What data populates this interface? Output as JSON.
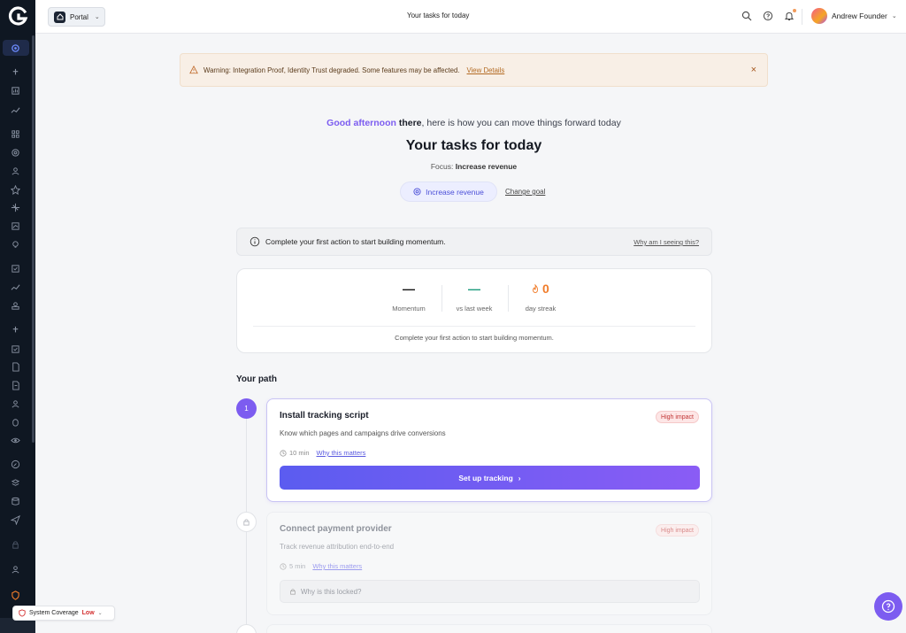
{
  "header": {
    "workspace_label": "Portal",
    "title": "Your tasks for today",
    "user_name": "Andrew Founder"
  },
  "warning": {
    "text": "Warning: Integration Proof, Identity Trust degraded. Some features may be affected.",
    "link": "View Details"
  },
  "hero": {
    "greeting": "Good afternoon",
    "name": "there",
    "rest": ", here is how you can move things forward today",
    "title": "Your tasks for today",
    "focus_label": "Focus:",
    "focus_value": "Increase revenue",
    "goal_pill": "Increase revenue",
    "change_goal": "Change goal"
  },
  "info": {
    "text": "Complete your first action to start building momentum.",
    "why": "Why am I seeing this?"
  },
  "stats": {
    "momentum_value": "—",
    "momentum_label": "Momentum",
    "week_value": "—",
    "week_label": "vs last week",
    "streak_value": "0",
    "streak_label": "day streak",
    "footer": "Complete your first action to start building momentum."
  },
  "path": {
    "heading": "Your path",
    "tasks": [
      {
        "step": "1",
        "title": "Install tracking script",
        "desc": "Know which pages and campaigns drive conversions",
        "badge": "High impact",
        "time": "10 min",
        "why": "Why this matters",
        "cta": "Set up tracking"
      },
      {
        "title": "Connect payment provider",
        "desc": "Track revenue attribution end-to-end",
        "badge": "High impact",
        "time": "5 min",
        "why": "Why this matters",
        "locked": "Why is this locked?"
      }
    ]
  },
  "coverage": {
    "label": "System Coverage",
    "level": "Low"
  },
  "colors": {
    "accent": "#7c5cf0",
    "rail": "#0f1722",
    "warning_bg": "#f8efe6",
    "streak": "#f07c2a",
    "week": "#1a9b7c"
  }
}
